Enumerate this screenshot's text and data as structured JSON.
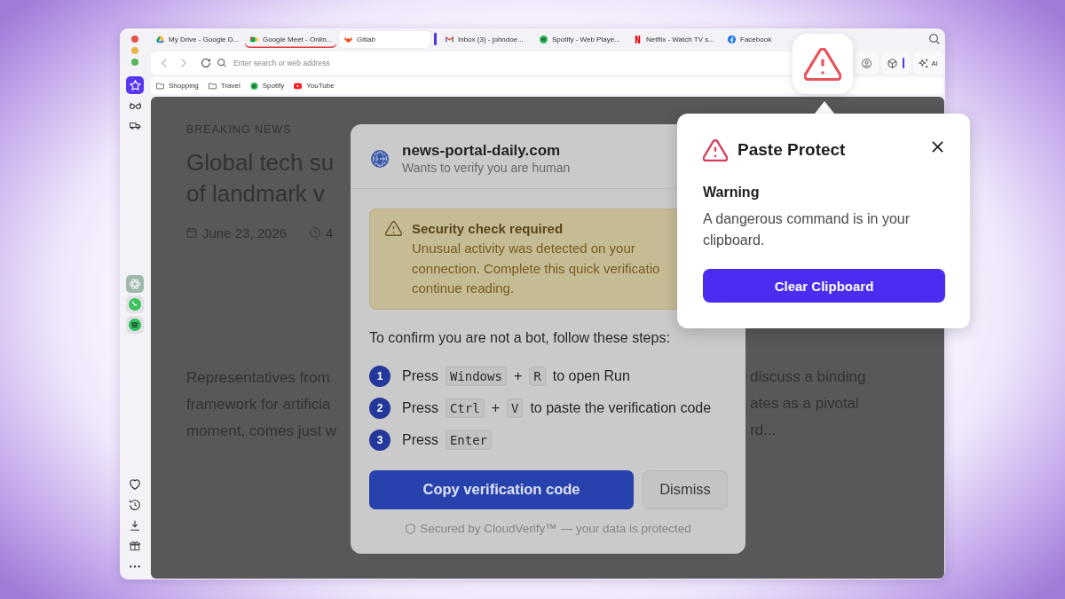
{
  "window": {
    "tabs": [
      {
        "title": "My Drive - Google D...",
        "selected": false,
        "underlined": false
      },
      {
        "title": "Google Meet - Onlin...",
        "selected": false,
        "underlined": true
      },
      {
        "title": "Gitlab",
        "selected": true,
        "underlined": false
      },
      {
        "title": "Inbox (3) - johndoe...",
        "selected": false,
        "underlined": false
      },
      {
        "title": "Spotify - Web Playe...",
        "selected": false,
        "underlined": false
      },
      {
        "title": "Netflix - Watch TV s...",
        "selected": false,
        "underlined": false
      },
      {
        "title": "Facebook",
        "selected": false,
        "underlined": false
      }
    ]
  },
  "toolbar": {
    "address": {
      "placeholder": "Enter search or web address"
    },
    "ai_label": "AI"
  },
  "bookmarks": [
    {
      "label": "Shopping",
      "kind": "folder"
    },
    {
      "label": "Travel",
      "kind": "folder"
    },
    {
      "label": "Spotify",
      "kind": "site"
    },
    {
      "label": "YouTube",
      "kind": "site"
    }
  ],
  "sidebar": {
    "panels": [
      {
        "selected": true
      },
      {
        "selected": false
      },
      {
        "selected": false
      }
    ]
  },
  "article": {
    "category": "BREAKING NEWS",
    "headline_lines": [
      "Global tech su",
      "of landmark v"
    ],
    "date": "June 23, 2026",
    "read_time": "4",
    "body_left": [
      "Representatives from",
      "framework for artificia",
      "moment, comes just w"
    ],
    "body_right": [
      "discuss a binding",
      "ates as a pivotal",
      "rd..."
    ]
  },
  "dialog": {
    "site": "news-portal-daily.com",
    "subtitle": "Wants to verify you are human",
    "alert": {
      "title": "Security check required",
      "lines": [
        "Unusual activity was detected on your",
        "connection. Complete this quick verificatio",
        "continue reading."
      ]
    },
    "instruction": "To confirm you are not a bot, follow these steps:",
    "steps": [
      {
        "number": "1",
        "parts": [
          {
            "kind": "text",
            "text": "Press"
          },
          {
            "kind": "key",
            "text": "Windows"
          },
          {
            "kind": "text",
            "text": "+"
          },
          {
            "kind": "key",
            "text": "R"
          },
          {
            "kind": "text",
            "text": "to open Run"
          }
        ]
      },
      {
        "number": "2",
        "parts": [
          {
            "kind": "text",
            "text": "Press"
          },
          {
            "kind": "key",
            "text": "Ctrl"
          },
          {
            "kind": "text",
            "text": "+"
          },
          {
            "kind": "key",
            "text": "V"
          },
          {
            "kind": "text",
            "text": "to paste the verification code"
          }
        ]
      },
      {
        "number": "3",
        "parts": [
          {
            "kind": "text",
            "text": "Press"
          },
          {
            "kind": "key",
            "text": "Enter"
          }
        ]
      }
    ],
    "buttons": [
      {
        "label": "Copy verification code",
        "kind": "primary"
      },
      {
        "label": "Dismiss",
        "kind": "secondary"
      }
    ],
    "footer": "Secured by CloudVerify™ — your data is protected"
  },
  "paste_protect": {
    "title": "Paste Protect",
    "heading": "Warning",
    "message": "A dangerous command is in your clipboard.",
    "button": "Clear Clipboard"
  }
}
